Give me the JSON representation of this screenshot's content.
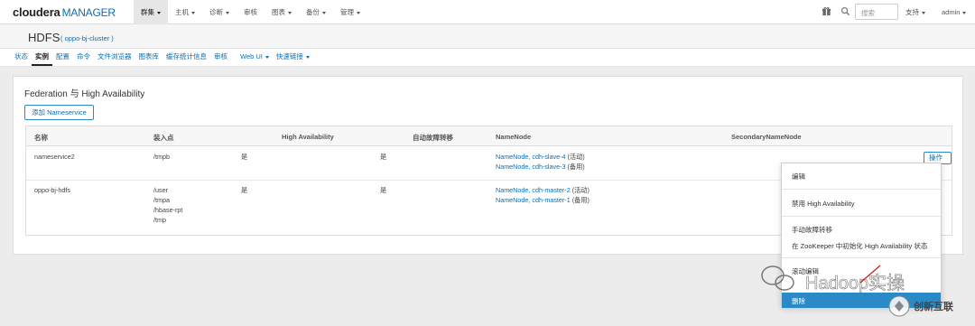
{
  "topbar": {
    "logo_brand": "cloudera",
    "logo_product": "MANAGER",
    "nav": [
      "群集",
      "主机",
      "诊断",
      "审核",
      "图表",
      "备份",
      "管理"
    ],
    "search_placeholder": "搜索",
    "support": "支持",
    "user": "admin"
  },
  "header": {
    "service": "HDFS",
    "cluster": "( oppo-bj-cluster )"
  },
  "tabs": [
    "状态",
    "实例",
    "配置",
    "命令",
    "文件浏览器",
    "图表库",
    "缓存统计信息",
    "审核",
    "Web UI",
    "快速链接"
  ],
  "panel": {
    "title": "Federation 与 High Availability",
    "add_button": "添加 Nameservice",
    "columns": [
      "名称",
      "装入点",
      "High Availability",
      "自动故障转移",
      "NameNode",
      "SecondaryNameNode"
    ],
    "rows": [
      {
        "name": "nameservice2",
        "mounts": [
          "/tmpb"
        ],
        "ha": "是",
        "failover": "是",
        "namenodes": [
          "NameNode, cdh-slave-4",
          "NameNode, cdh-slave-3"
        ],
        "states": [
          " (活动)",
          " (备用)"
        ],
        "action": "操作"
      },
      {
        "name": "oppo-bj-hdfs",
        "mounts": [
          "/user",
          "/tmpa",
          "/hbase-rpt",
          "/tmp"
        ],
        "ha": "是",
        "failover": "是",
        "namenodes": [
          "NameNode, cdh-master-2",
          "NameNode, cdh-master-1"
        ],
        "states": [
          " (活动)",
          " (备用)"
        ]
      }
    ]
  },
  "menu": {
    "items": [
      "编辑",
      "禁用 High Availability",
      "手动故障转移",
      "在 ZooKeeper 中初始化 High Availability 状态",
      "滚动编辑",
      "删除"
    ]
  },
  "watermark": {
    "text": "Hadoop实操",
    "brand": "创新互联"
  },
  "colors": {
    "link": "#0a6fb3",
    "highlight": "#2a8ac8"
  }
}
